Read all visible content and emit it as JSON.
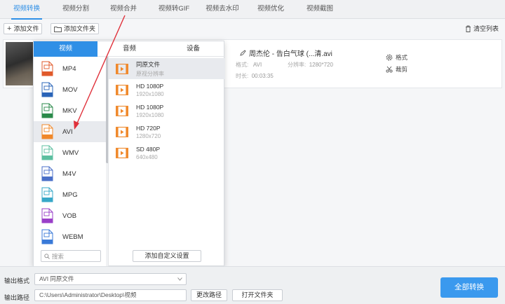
{
  "tabs": [
    {
      "label": "视频转换",
      "active": true
    },
    {
      "label": "视频分割",
      "active": false
    },
    {
      "label": "视频合并",
      "active": false
    },
    {
      "label": "视频转GIF",
      "active": false
    },
    {
      "label": "视频去水印",
      "active": false
    },
    {
      "label": "视频优化",
      "active": false
    },
    {
      "label": "视频截图",
      "active": false
    }
  ],
  "toolbar": {
    "add_file": "添加文件",
    "add_folder": "添加文件夹",
    "clear_list": "清空列表"
  },
  "file": {
    "name": "周杰伦 - 告白气球 (...清.avi",
    "format_label": "格式:",
    "format_value": "AVI",
    "res_label": "分辨率:",
    "res_value": "1280*720",
    "duration_label": "时长:",
    "duration_value": "00:03:35",
    "format_action": "格式",
    "cut_action": "裁剪"
  },
  "popup": {
    "tabs": [
      "视频",
      "音频",
      "设备"
    ],
    "active_tab": "视频",
    "formats": [
      {
        "label": "MP4",
        "badge": "MP4",
        "color": "#e05a2b"
      },
      {
        "label": "MOV",
        "badge": "MOV",
        "color": "#2a64b8"
      },
      {
        "label": "MKV",
        "badge": "MKV",
        "color": "#2a8a4a"
      },
      {
        "label": "AVI",
        "badge": "AVI",
        "color": "#f0882a"
      },
      {
        "label": "WMV",
        "badge": "WMV",
        "color": "#5cbfa0"
      },
      {
        "label": "M4V",
        "badge": "M4V",
        "color": "#4a6fc8"
      },
      {
        "label": "MPG",
        "badge": "MPG",
        "color": "#38a8c8"
      },
      {
        "label": "VOB",
        "badge": "VOB",
        "color": "#9a3fc8"
      },
      {
        "label": "WEBM",
        "badge": "WEBM",
        "color": "#3a7ad8"
      }
    ],
    "selected_format": "AVI",
    "search_placeholder": "搜索",
    "qualities": [
      {
        "title": "同原文件",
        "sub": "原视分辨率"
      },
      {
        "title": "HD 1080P",
        "sub": "1920x1080"
      },
      {
        "title": "HD 1080P",
        "sub": "1920x1080"
      },
      {
        "title": "HD 720P",
        "sub": "1280x720"
      },
      {
        "title": "SD 480P",
        "sub": "640x480"
      }
    ],
    "custom_button": "添加自定义设置"
  },
  "bottom": {
    "format_label": "输出格式",
    "format_value": "AVI  同原文件",
    "path_label": "输出路径",
    "path_value": "C:\\Users\\Administrator\\Desktop\\视频",
    "change_path": "更改路径",
    "open_folder": "打开文件夹",
    "convert_all": "全部转换"
  },
  "colors": {
    "accent": "#2f8fe6",
    "convert": "#3a99ee",
    "video_icon": "#f0882a",
    "arrow": "#e0303a"
  }
}
